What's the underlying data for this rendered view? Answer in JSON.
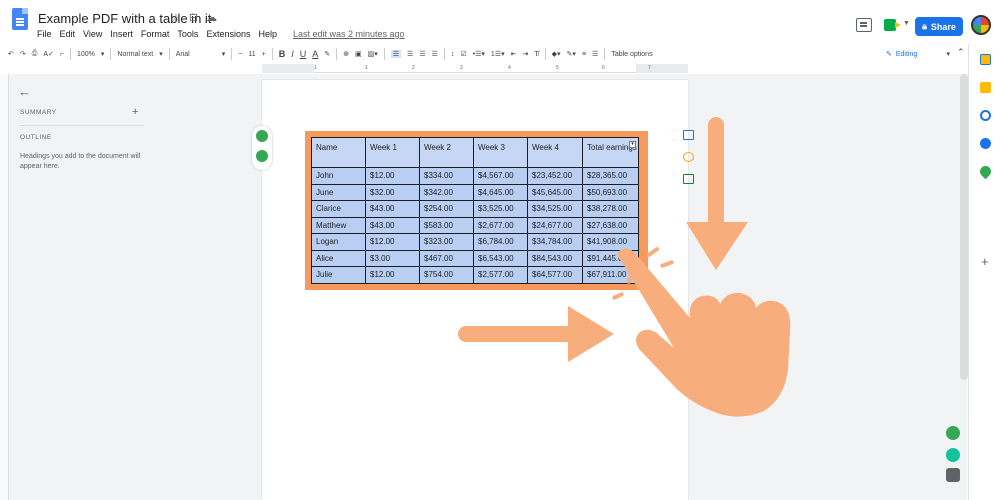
{
  "title_bar": {
    "doc_title": "Example PDF with a table in it",
    "star_icon": "star-icon",
    "move_icon": "folder-move-icon",
    "cloud_icon": "cloud-saved-icon"
  },
  "menu": {
    "items": [
      "File",
      "Edit",
      "View",
      "Insert",
      "Format",
      "Tools",
      "Extensions",
      "Help"
    ],
    "last_edit": "Last edit was 2 minutes ago"
  },
  "header_actions": {
    "share_label": "Share",
    "share_icon": "lock-icon",
    "share_color": "#1a73e8"
  },
  "toolbar": {
    "zoom": "100%",
    "style": "Normal text",
    "font": "Arial",
    "font_size": "11",
    "bold": "B",
    "italic": "I",
    "underline": "U",
    "text_color": "A",
    "table_options": "Table options",
    "mode": "Editing"
  },
  "ruler": {
    "ticks": [
      "1",
      "1",
      "2",
      "3",
      "4",
      "5",
      "6",
      "7"
    ]
  },
  "outline_panel": {
    "summary_label": "SUMMARY",
    "outline_label": "OUTLINE",
    "hint": "Headings you add to the document will appear here."
  },
  "table": {
    "headers": [
      "Name",
      "Week 1",
      "Week 2",
      "Week 3",
      "Week 4",
      "Total earnings"
    ],
    "rows": [
      [
        "John",
        "$12.00",
        "$334.00",
        "$4,567.00",
        "$23,452.00",
        "$28,365.00"
      ],
      [
        "June",
        "$32.00",
        "$342.00",
        "$4,645.00",
        "$45,645.00",
        "$50,693.00"
      ],
      [
        "Clarice",
        "$43.00",
        "$254.00",
        "$3,525.00",
        "$34,525.00",
        "$38,278.00"
      ],
      [
        "Matthew",
        "$43.00",
        "$583.00",
        "$2,677.00",
        "$24,677.00",
        "$27,638.00"
      ],
      [
        "Logan",
        "$12.00",
        "$323.00",
        "$6,784.00",
        "$34,784.00",
        "$41,908.00"
      ],
      [
        "Alice",
        "$3.00",
        "$467.00",
        "$6,543.00",
        "$84,543.00",
        "$91,445.00"
      ],
      [
        "Julie",
        "$12.00",
        "$754.00",
        "$2,577.00",
        "$64,577.00",
        "$67,911.00"
      ]
    ],
    "frame_color": "#f59a5c",
    "cell_color": "#b8cff3"
  },
  "overlay": {
    "arrow_color": "#f7ae7c",
    "icons": [
      "down-arrow-icon",
      "right-arrow-icon",
      "pointing-hand-icon"
    ]
  },
  "colors": {
    "docs_blue": "#4285f4",
    "canvas_bg": "#f1f3f4"
  }
}
